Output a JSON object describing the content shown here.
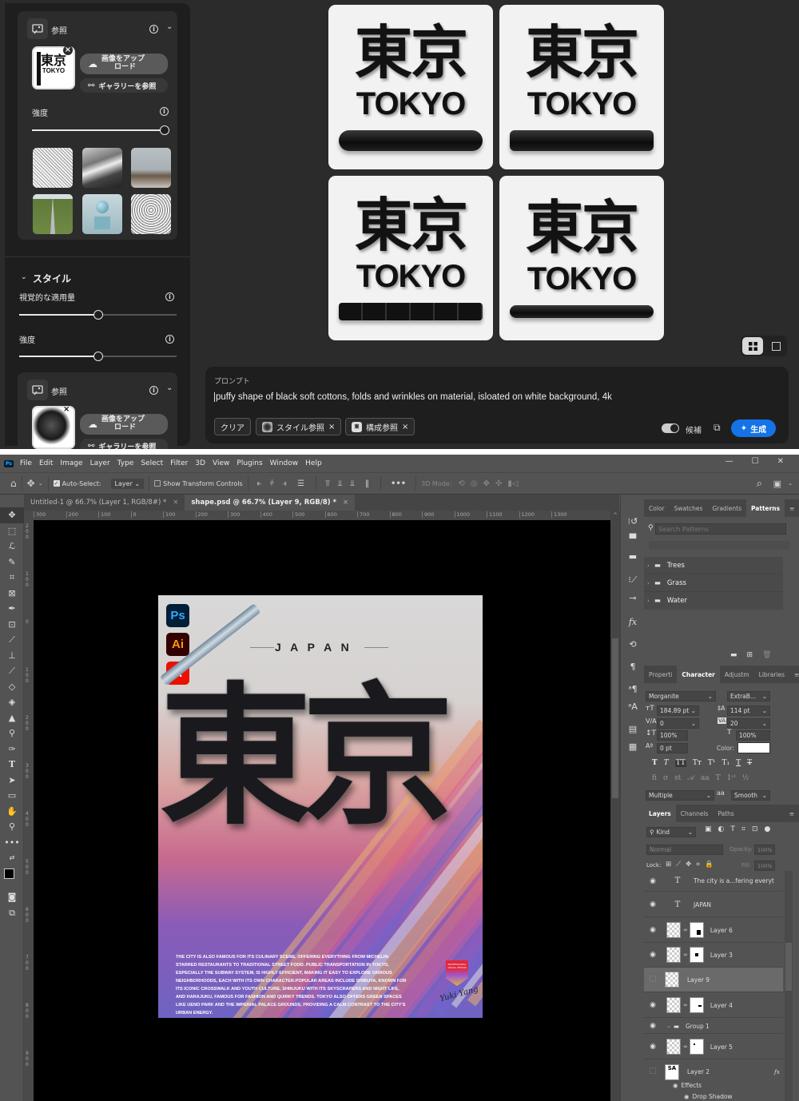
{
  "firefly": {
    "left_panel": {
      "top_reference": {
        "title": "参照",
        "thumb_kanji": "東京",
        "thumb_text": "TOKYO",
        "upload_label": "画像をアップロード",
        "upload_line1": "画像をアップ",
        "upload_line2": "ロード",
        "gallery_label": "ギャラリーを参照",
        "strength_label": "強度",
        "strength_value": 1.0,
        "gallery_thumbs": [
          "bird-sketch",
          "river-landscape",
          "living-room",
          "country-road",
          "blue-sphere-cube",
          "owl-sketch"
        ]
      },
      "style_section": {
        "title": "スタイル",
        "visual_intensity_label": "視覚的な適用量",
        "visual_intensity_value": 0.5,
        "strength_label": "強度",
        "strength_value": 0.5
      },
      "style_reference": {
        "title": "参照",
        "upload_line1": "画像をアップ",
        "upload_line2": "ロード",
        "gallery_label": "ギャラリーを参照"
      }
    },
    "results": {
      "images": [
        {
          "kanji": "東京",
          "text": "TOKYO"
        },
        {
          "kanji": "東京",
          "text": "TOKYO"
        },
        {
          "kanji": "東京",
          "text": "TOKYO"
        },
        {
          "kanji": "東京",
          "text": "TOKYO"
        }
      ],
      "view_grid_selected": true
    },
    "prompt": {
      "label": "プロンプト",
      "text": "puffy shape of black soft cottons, folds and wrinkles on material, isloated on white background, 4k",
      "clear_label": "クリア",
      "style_ref_chip": "スタイル参照",
      "composition_ref_chip": "構成参照",
      "suggestions_label": "候補",
      "suggestions_on": true,
      "generate_label": "生成",
      "accent_color": "#1473e6"
    }
  },
  "photoshop": {
    "app_icon": "Ps",
    "menu": [
      "File",
      "Edit",
      "Image",
      "Layer",
      "Type",
      "Select",
      "Filter",
      "3D",
      "View",
      "Plugins",
      "Window",
      "Help"
    ],
    "options": {
      "auto_select_label": "Auto-Select:",
      "auto_select_checked": true,
      "auto_select_target": "Layer",
      "show_transform_label": "Show Transform Controls",
      "show_transform_checked": false,
      "mode_3d_label": "3D Mode:"
    },
    "doc_tabs": [
      {
        "label": "Untitled-1 @ 66.7% (Layer 1, RGB/8#) *",
        "active": false
      },
      {
        "label": "shape.psd @ 66.7% (Layer 9, RGB/8) *",
        "active": true
      }
    ],
    "ruler_top": [
      "300",
      "200",
      "100",
      "0",
      "100",
      "200",
      "300",
      "400",
      "500",
      "600",
      "700",
      "800",
      "900",
      "1000",
      "1100",
      "1200",
      "1300"
    ],
    "ruler_left": [
      "200",
      "100",
      "0",
      "100",
      "200",
      "300",
      "400",
      "500",
      "600",
      "700",
      "800",
      "900"
    ],
    "patterns_panel": {
      "tabs": [
        "Color",
        "Swatches",
        "Gradients",
        "Patterns"
      ],
      "active_tab": "Patterns",
      "search_placeholder": "Search Patterns",
      "folders": [
        "Trees",
        "Grass",
        "Water"
      ]
    },
    "character_panel": {
      "tabs": [
        "Properti",
        "Character",
        "Adjustm",
        "Libraries"
      ],
      "active_tab": "Character",
      "font_family": "Morganite",
      "font_style": "ExtraB...",
      "font_size": "184.89 pt",
      "leading": "114 pt",
      "kerning": "0",
      "tracking": "20",
      "vertical_scale": "100%",
      "horizontal_scale": "100%",
      "baseline_shift": "0 pt",
      "color_label": "Color:",
      "color_value": "#ffffff",
      "language": "Multiple",
      "antialias_label": "aa",
      "antialias": "Smooth"
    },
    "layers_panel": {
      "tabs": [
        "Layers",
        "Channels",
        "Paths"
      ],
      "active_tab": "Layers",
      "filter_kind": "Kind",
      "blend_mode": "Normal",
      "opacity_label": "Opacity:",
      "opacity": "100%",
      "lock_label": "Lock:",
      "fill_label": "Fill:",
      "fill": "100%",
      "layers": [
        {
          "name": "The city is a...fering everyt",
          "type": "text",
          "visible": true
        },
        {
          "name": "JAPAN",
          "type": "text",
          "visible": true
        },
        {
          "name": "Layer 6",
          "type": "masked",
          "visible": true
        },
        {
          "name": "Layer 3",
          "type": "masked",
          "visible": true
        },
        {
          "name": "Layer 9",
          "type": "smart",
          "visible": false,
          "selected": true
        },
        {
          "name": "Layer 4",
          "type": "masked",
          "visible": true
        },
        {
          "name": "Group 1",
          "type": "group",
          "visible": true
        },
        {
          "name": "Layer 5",
          "type": "masked",
          "visible": true
        },
        {
          "name": "Layer 2",
          "type": "smart",
          "visible": false,
          "fx": true
        }
      ],
      "effects_label": "Effects",
      "drop_shadow_label": "Drop Shadow"
    },
    "poster": {
      "app_badges": [
        "Ps",
        "Ai",
        "A"
      ],
      "subtitle": "J A P A N",
      "headline": "東京",
      "body_text": "THE CITY IS ALSO FAMOUS FOR ITS CULINARY SCENE, OFFERING EVERYTHING FROM MICHELIN-STARRED RESTAURANTS TO TRADITIONAL STREET FOOD. PUBLIC TRANSPORTATION IN TOKYO, ESPECIALLY THE SUBWAY SYSTEM, IS HIGHLY EFFICIENT, MAKING IT EASY TO EXPLORE VARIOUS NEIGHBORHOODS, EACH WITH ITS OWN CHARACTER.POPULAR AREAS INCLUDE SHIBUYA, KNOWN FOR ITS ICONIC CROSSWALK AND YOUTH CULTURE, SHINJUKU WITH ITS SKYSCRAPERS AND NIGHT LIFE, AND HARAJUKU, FAMOUS FOR FASHION AND QUIRKY TRENDS. TOKYO ALSO OFFERS GREEN SPACES LIKE UENO PARK AND THE IMPERIAL PALACE GROUNDS, PROVIDING A CALM CONTRAST TO THE CITY'S URBAN ENERGY.",
      "badge_line1": "PROFESSIONAL",
      "badge_line2": "VISUAL DESIGN",
      "signature": "Yuki Yang"
    }
  }
}
